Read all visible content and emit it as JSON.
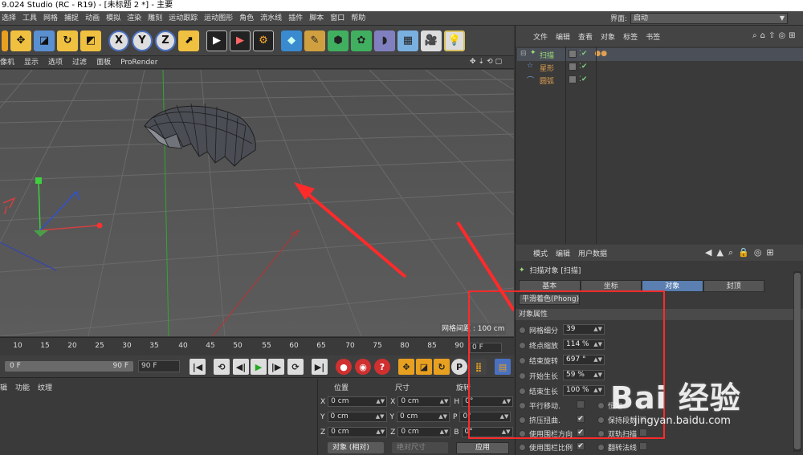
{
  "titlebar": {
    "text": "9.024 Studio (RC - R19) - [未标题 2 *] - 主要"
  },
  "menubar": {
    "items": [
      "选择",
      "工具",
      "网格",
      "捕捉",
      "动画",
      "模拟",
      "渲染",
      "雕刻",
      "运动跟踪",
      "运动图形",
      "角色",
      "流水线",
      "插件",
      "脚本",
      "窗口",
      "帮助"
    ],
    "layout_label": "界面:",
    "layout_value": "启动"
  },
  "viewport_menu": {
    "items": [
      "像机",
      "显示",
      "选项",
      "过滤",
      "面板",
      "ProRender"
    ],
    "grid_label": "网格间距 : 100 cm"
  },
  "timeline": {
    "ticks": [
      "10",
      "15",
      "20",
      "25",
      "30",
      "35",
      "40",
      "45",
      "50",
      "55",
      "60",
      "65",
      "70",
      "75",
      "80",
      "85",
      "90"
    ],
    "current_frame": "0 F",
    "range_start": "0 F",
    "range_end": "90 F",
    "end_frame": "90 F"
  },
  "material_menu": {
    "items": [
      "辑",
      "功能",
      "纹理"
    ]
  },
  "coords": {
    "headers": {
      "position": "位置",
      "size": "尺寸",
      "rotation": "旋转"
    },
    "rows": [
      {
        "axis": "X",
        "pos": "0 cm",
        "saxis": "X",
        "size": "0 cm",
        "raxis": "H",
        "rot": "0°"
      },
      {
        "axis": "Y",
        "pos": "0 cm",
        "saxis": "Y",
        "size": "0 cm",
        "raxis": "P",
        "rot": "0°"
      },
      {
        "axis": "Z",
        "pos": "0 cm",
        "saxis": "Z",
        "size": "0 cm",
        "raxis": "B",
        "rot": "0°"
      }
    ],
    "mode": "对象 (相对)",
    "size_mode": "绝对尺寸",
    "apply": "应用"
  },
  "object_manager": {
    "menu": [
      "文件",
      "编辑",
      "查看",
      "对象",
      "标签",
      "书签"
    ],
    "objects": [
      {
        "name": "扫描",
        "color": "#9ce07a"
      },
      {
        "name": "星形",
        "color": "#e0a050"
      },
      {
        "name": "圆弧",
        "color": "#e0a050"
      }
    ]
  },
  "attributes": {
    "menu": [
      "模式",
      "编辑",
      "用户数据"
    ],
    "title": "扫描对象 [扫描]",
    "tabs": [
      "基本",
      "坐标",
      "对象",
      "封顶"
    ],
    "active_tab": "对象",
    "phong_tab": "平滑着色(Phong)",
    "section": "对象属性",
    "props": [
      {
        "label": "网格细分",
        "value": "39"
      },
      {
        "label": "终点缩放",
        "value": "114 %"
      },
      {
        "label": "结束旋转",
        "value": "697 °"
      },
      {
        "label": "开始生长",
        "value": "59 %"
      },
      {
        "label": "结束生长",
        "value": "100 %"
      }
    ],
    "checks_left": [
      {
        "label": "平行移动.",
        "checked": ""
      },
      {
        "label": "挤压扭曲.",
        "checked": "✔"
      },
      {
        "label": "使用围栏方向",
        "checked": "✔"
      },
      {
        "label": "使用围栏比例",
        "checked": "✔"
      }
    ],
    "checks_right": [
      {
        "label": "恒定",
        "checked": ""
      },
      {
        "label": "保持段数",
        "checked": ""
      },
      {
        "label": "双轨扫描",
        "checked": ""
      },
      {
        "label": "翻转法线",
        "checked": ""
      }
    ]
  },
  "watermark": {
    "text": "Bai 经验",
    "url": "jingyan.baidu.com"
  }
}
